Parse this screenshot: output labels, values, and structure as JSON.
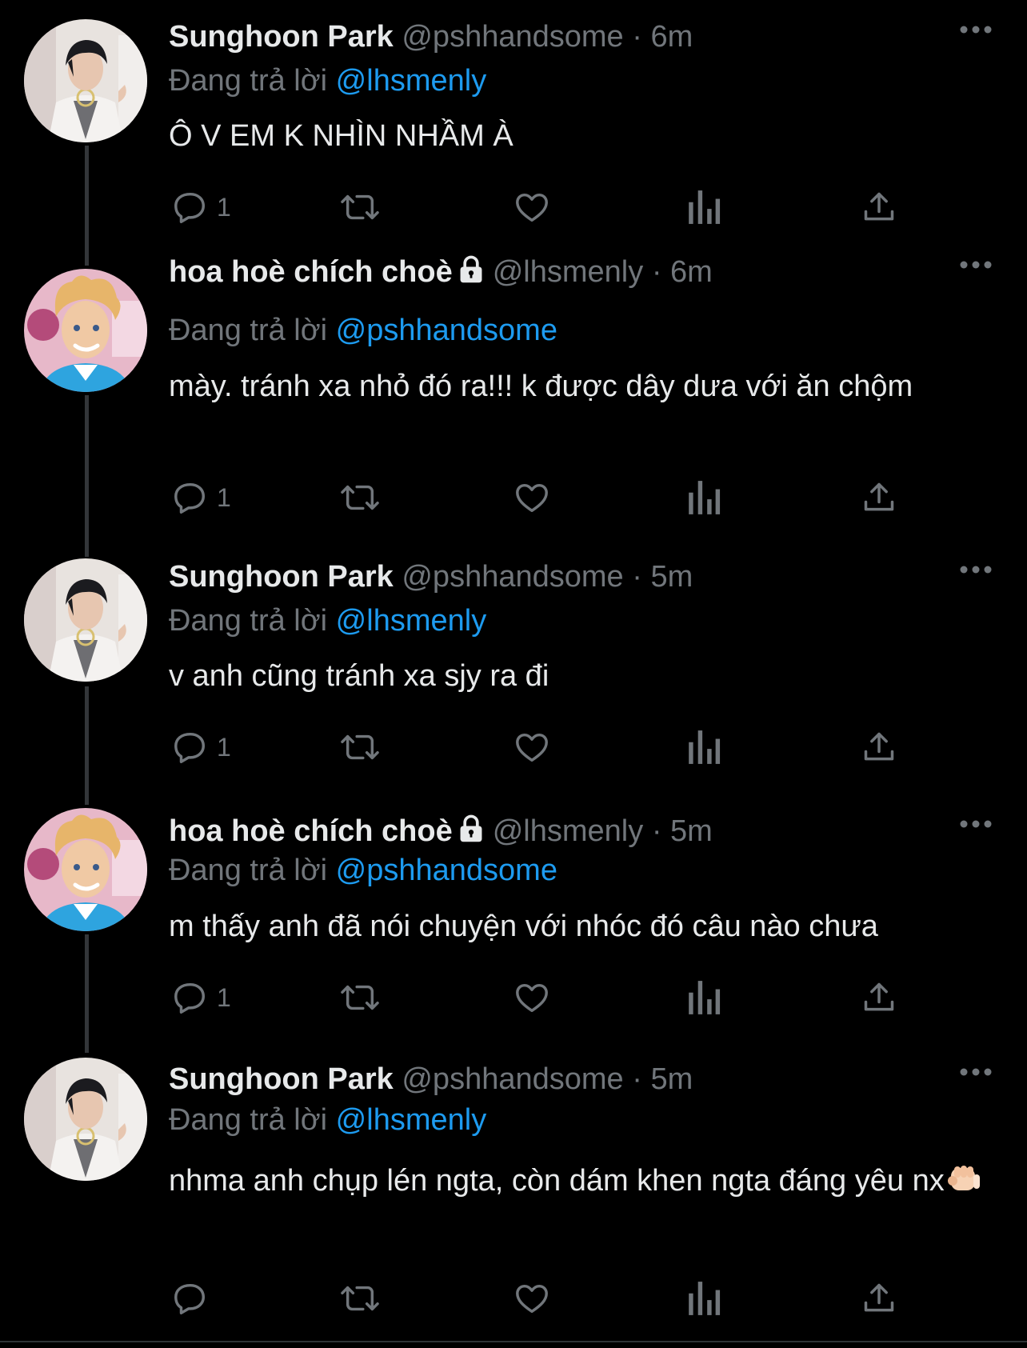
{
  "tweets": [
    {
      "name": "Sunghoon Park",
      "handle": "@pshhandsome",
      "separator": "·",
      "time": "6m",
      "reply_prefix": "Đang trả lời",
      "reply_to": "@lhsmenly",
      "text": "Ô V EM K NHÌN NHẦM À",
      "reply_count": "1",
      "locked": false,
      "avatar": "sunghoon-avatar"
    },
    {
      "name": "hoa hoè chích choè",
      "handle": "@lhsmenly",
      "separator": "·",
      "time": "6m",
      "reply_prefix": "Đang trả lời",
      "reply_to": "@pshhandsome",
      "text": "mày. tránh xa nhỏ đó ra!!! k được dây dưa với ăn chộm",
      "reply_count": "1",
      "locked": true,
      "avatar": "ken-avatar"
    },
    {
      "name": "Sunghoon Park",
      "handle": "@pshhandsome",
      "separator": "·",
      "time": "5m",
      "reply_prefix": "Đang trả lời",
      "reply_to": "@lhsmenly",
      "text": "v anh cũng tránh xa sjy ra đi",
      "reply_count": "1",
      "locked": false,
      "avatar": "sunghoon-avatar"
    },
    {
      "name": "hoa hoè chích choè",
      "handle": "@lhsmenly",
      "separator": "·",
      "time": "5m",
      "reply_prefix": "Đang trả lời",
      "reply_to": "@pshhandsome",
      "text": "m thấy anh đã nói chuyện với nhóc đó câu nào chưa",
      "reply_count": "1",
      "locked": true,
      "avatar": "ken-avatar"
    },
    {
      "name": "Sunghoon Park",
      "handle": "@pshhandsome",
      "separator": "·",
      "time": "5m",
      "reply_prefix": "Đang trả lời",
      "reply_to": "@lhsmenly",
      "text": "nhma anh chụp lén ngta, còn dám khen ngta đáng yêu nx",
      "text_emoji": "fist-emoji",
      "reply_count": "",
      "locked": false,
      "avatar": "sunghoon-avatar"
    }
  ],
  "icons": {
    "reply": "reply-icon",
    "retweet": "retweet-icon",
    "like": "heart-icon",
    "views": "analytics-icon",
    "share": "share-icon",
    "more": "more-icon",
    "lock": "lock-icon"
  },
  "colors": {
    "background": "#000000",
    "text": "#e7e9ea",
    "secondary": "#71767b",
    "link": "#1d9bf0",
    "thread_line": "#333639"
  }
}
